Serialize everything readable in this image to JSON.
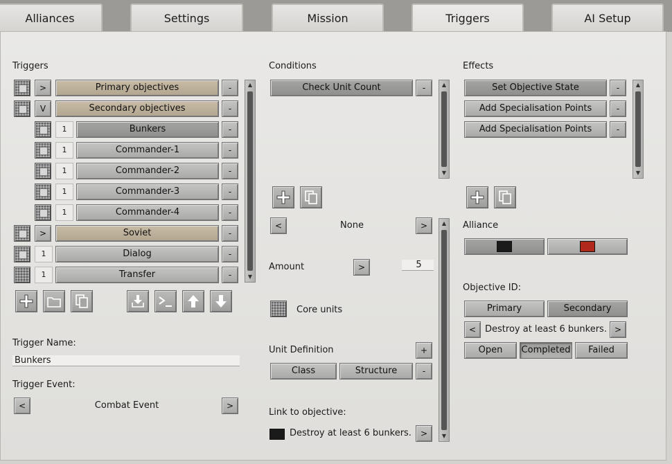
{
  "tabs": [
    {
      "label": "Alliances"
    },
    {
      "label": "Settings"
    },
    {
      "label": "Mission"
    },
    {
      "label": "Triggers"
    },
    {
      "label": "AI Setup"
    }
  ],
  "triggers": {
    "heading": "Triggers",
    "items": [
      {
        "expand": ">",
        "label": "Primary objectives",
        "remove": "-"
      },
      {
        "expand": "V",
        "label": "Secondary objectives",
        "remove": "-"
      },
      {
        "count": "1",
        "label": "Bunkers",
        "remove": "-"
      },
      {
        "count": "1",
        "label": "Commander-1",
        "remove": "-"
      },
      {
        "count": "1",
        "label": "Commander-2",
        "remove": "-"
      },
      {
        "count": "1",
        "label": "Commander-3",
        "remove": "-"
      },
      {
        "count": "1",
        "label": "Commander-4",
        "remove": "-"
      },
      {
        "expand": ">",
        "label": "Soviet",
        "remove": "-"
      },
      {
        "count": "1",
        "label": "Dialog",
        "remove": "-"
      },
      {
        "count": "1",
        "label": "Transfer",
        "remove": "-"
      }
    ],
    "name_label": "Trigger Name:",
    "name_value": "Bunkers",
    "event_label": "Trigger Event:",
    "event_value": "Combat Event",
    "prev": "<",
    "next": ">"
  },
  "conditions": {
    "heading": "Conditions",
    "items": [
      {
        "label": "Check Unit Count",
        "remove": "-"
      }
    ],
    "selector_prev": "<",
    "selector_value": "None",
    "selector_next": ">",
    "amount_label": "Amount",
    "amount_btn": ">",
    "amount_value": "5",
    "core_units_label": "Core units",
    "unit_def_label": "Unit Definition",
    "unit_def_add": "+",
    "unit_def_remove": "-",
    "class_label": "Class",
    "structure_label": "Structure",
    "link_label": "Link to objective:",
    "link_value": "Destroy at least 6 bunkers.",
    "link_btn": ">"
  },
  "effects": {
    "heading": "Effects",
    "items": [
      {
        "label": "Set Objective State",
        "remove": "-"
      },
      {
        "label": "Add Specialisation Points",
        "remove": "-"
      },
      {
        "label": "Add Specialisation Points",
        "remove": "-"
      }
    ],
    "alliance_label": "Alliance",
    "alliance_colors": [
      "#1a1a1a",
      "#b0281c"
    ],
    "objective_label": "Objective ID:",
    "primary_label": "Primary",
    "secondary_label": "Secondary",
    "objective_prev": "<",
    "objective_value": "Destroy at least 6 bunkers.",
    "objective_next": ">",
    "open_label": "Open",
    "completed_label": "Completed",
    "failed_label": "Failed"
  },
  "colors": {
    "tan": "#bfb19b",
    "panel": "#e4e3e1",
    "button": "#b6b6b5"
  }
}
